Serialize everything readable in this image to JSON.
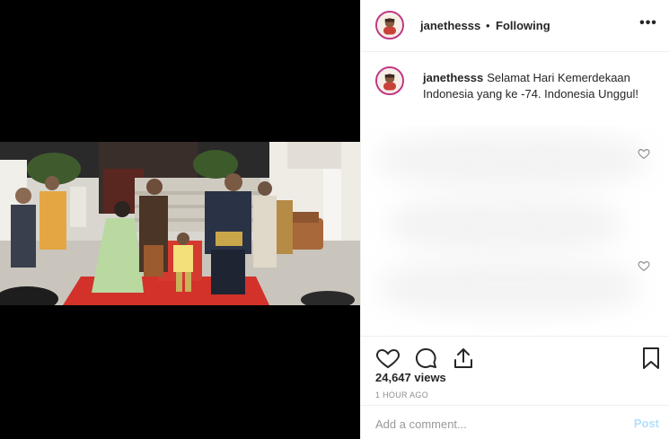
{
  "post": {
    "username": "janethesss",
    "separator": "•",
    "follow_status": "Following",
    "more_label": "•••",
    "caption_text": "Selamat Hari Kemerdekaan Indonesia yang ke -74. Indonesia Unggul!",
    "views": "24,647 views",
    "time": "1 HOUR AGO"
  },
  "comment": {
    "placeholder": "Add a comment...",
    "post_label": "Post"
  },
  "icons": {
    "header_more": "more-options-icon",
    "like": "heart-icon",
    "comment": "speech-bubble-icon",
    "share": "share-icon",
    "save": "bookmark-icon"
  },
  "colors": {
    "avatar_ring": "#c13584",
    "post_button_disabled": "#b2dffc",
    "muted_text": "#8e8e8e"
  }
}
